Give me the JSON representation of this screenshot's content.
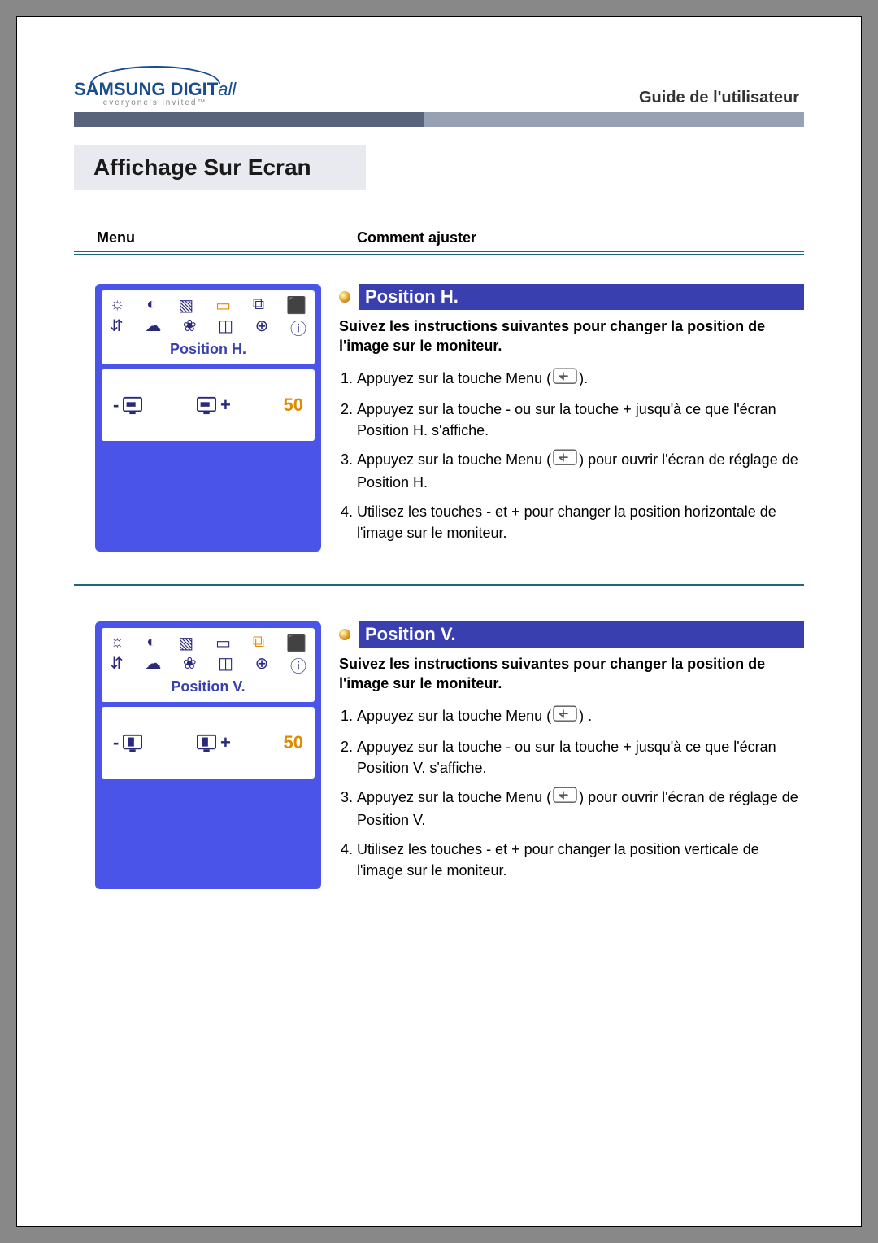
{
  "brand": {
    "name": "SAMSUNG DIGIT",
    "suffix": "all",
    "tagline": "everyone's invited™"
  },
  "header": {
    "guide": "Guide de l'utilisateur"
  },
  "page_title": "Affichage Sur Ecran",
  "columns": {
    "menu": "Menu",
    "adjust": "Comment ajuster"
  },
  "sections": [
    {
      "osd_label": "Position H.",
      "osd_value": "50",
      "title": "Position H.",
      "subtitle": "Suivez les instructions suivantes pour changer la position de l'image sur le moniteur.",
      "steps": [
        {
          "pre": "Appuyez sur la touche Menu  (",
          "icon": true,
          "post": ")."
        },
        {
          "pre": "Appuyez sur la touche - ou sur la touche + jusqu'à ce que l'écran Position H. s'affiche.",
          "icon": false,
          "post": ""
        },
        {
          "pre": "Appuyez sur la touche Menu (",
          "icon": true,
          "post": ") pour ouvrir l'écran de réglage de Position H."
        },
        {
          "pre": "Utilisez les touches - et + pour changer la position horizontale de l'image sur le moniteur.",
          "icon": false,
          "post": ""
        }
      ],
      "osd_type": "h"
    },
    {
      "osd_label": "Position V.",
      "osd_value": "50",
      "title": "Position V.",
      "subtitle": "Suivez les instructions suivantes pour changer la position de l'image sur le moniteur.",
      "steps": [
        {
          "pre": "Appuyez sur la touche Menu  (",
          "icon": true,
          "post": ") ."
        },
        {
          "pre": "Appuyez sur la touche - ou sur la touche + jusqu'à ce que l'écran Position V. s'affiche.",
          "icon": false,
          "post": ""
        },
        {
          "pre": "Appuyez sur la touche Menu (",
          "icon": true,
          "post": ") pour ouvrir l'écran de réglage de Position V."
        },
        {
          "pre": "Utilisez les touches - et + pour changer la position verticale de l'image sur le moniteur.",
          "icon": false,
          "post": ""
        }
      ],
      "osd_type": "v"
    }
  ]
}
